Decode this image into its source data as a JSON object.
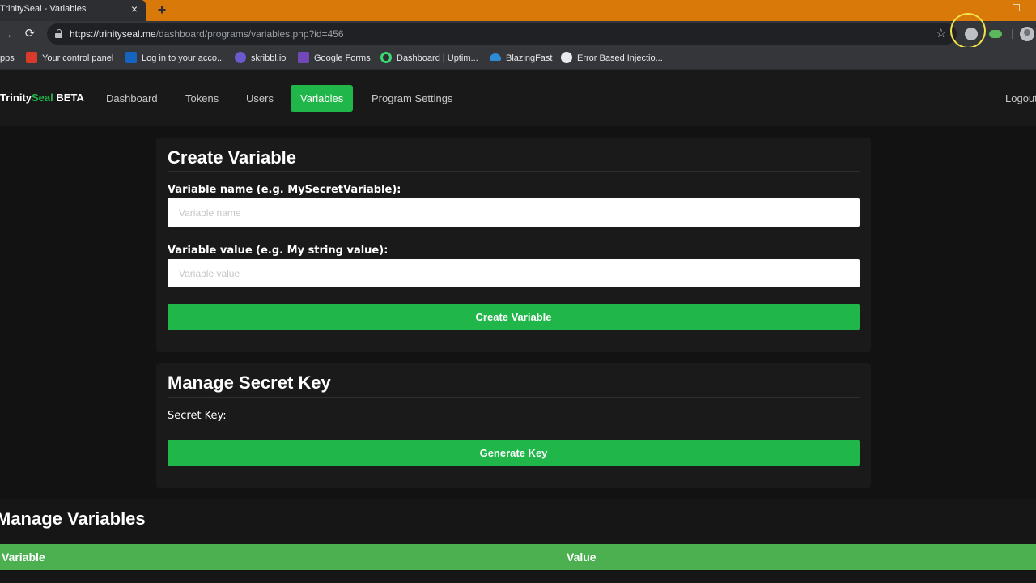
{
  "browser": {
    "tab_title": "TrinitySeal - Variables",
    "tab_close": "×",
    "new_tab": "+",
    "url_host": "https://trinityseal.me",
    "url_path": "/dashboard/programs/variables.php?id=456",
    "star": "☆",
    "reload": "⟳",
    "forward": "→"
  },
  "bookmarks": [
    {
      "label": "pps",
      "icon_color": "#35363a"
    },
    {
      "label": "Your control panel",
      "icon_color": "#d93a2b"
    },
    {
      "label": "Log in to your acco...",
      "icon_color": "#1565c0"
    },
    {
      "label": "skribbl.io",
      "icon_color": "#6a5acd"
    },
    {
      "label": "Google Forms",
      "icon_color": "#7248b9"
    },
    {
      "label": "Dashboard | Uptim...",
      "icon_color": "#3bd671"
    },
    {
      "label": "BlazingFast",
      "icon_color": "#2e8bd6"
    },
    {
      "label": "Error Based Injectio...",
      "icon_color": "#e8eaed"
    }
  ],
  "site": {
    "brand_prefix": "Trinity",
    "brand_seal": "Seal",
    "brand_suffix": " BETA",
    "nav": [
      "Dashboard",
      "Tokens",
      "Users",
      "Variables",
      "Program Settings"
    ],
    "active_nav": "Variables",
    "logout": "Logout",
    "accent": "#21b64a"
  },
  "create_variable": {
    "title": "Create Variable",
    "name_label": "Variable name (e.g. MySecretVariable):",
    "name_placeholder": "Variable name",
    "value_label": "Variable value (e.g. My string value):",
    "value_placeholder": "Variable value",
    "button": "Create Variable"
  },
  "secret_key": {
    "title": "Manage Secret Key",
    "label": "Secret Key:",
    "button": "Generate Key"
  },
  "manage_variables": {
    "title": "Manage Variables",
    "columns": [
      "Variable",
      "Value"
    ]
  }
}
